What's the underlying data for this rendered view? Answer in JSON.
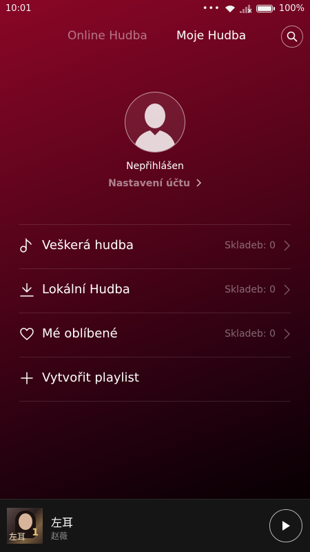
{
  "status_bar": {
    "time": "10:01",
    "dots": "•••",
    "battery_percent": "100%",
    "battery_level": 1.0,
    "icons": [
      "wifi-icon",
      "signal-icon",
      "battery-icon"
    ]
  },
  "header": {
    "tabs": [
      {
        "label": "Online Hudba",
        "active": false
      },
      {
        "label": "Moje Hudba",
        "active": true
      }
    ],
    "search_icon": "search-icon"
  },
  "profile": {
    "name": "Nepřihlášen",
    "account_link": "Nastavení účtu",
    "avatar_icon": "default-avatar-icon"
  },
  "menu": {
    "items": [
      {
        "label": "Veškerá hudba",
        "count": "Skladeb: 0",
        "icon": "music-note-icon"
      },
      {
        "label": "Lokální Hudba",
        "count": "Skladeb: 0",
        "icon": "download-icon"
      },
      {
        "label": "Mé oblíbené",
        "count": "Skladeb: 0",
        "icon": "heart-icon"
      },
      {
        "label": "Vytvořit playlist",
        "icon": "plus-icon"
      }
    ]
  },
  "player": {
    "title": "左耳",
    "artist": "赵薇",
    "cover_text": "左耳",
    "cover_number": "1",
    "play_icon": "play-icon"
  },
  "colors": {
    "gradient_top": "#8a0626",
    "gradient_bottom": "#030001",
    "player_bg": "#151515"
  }
}
